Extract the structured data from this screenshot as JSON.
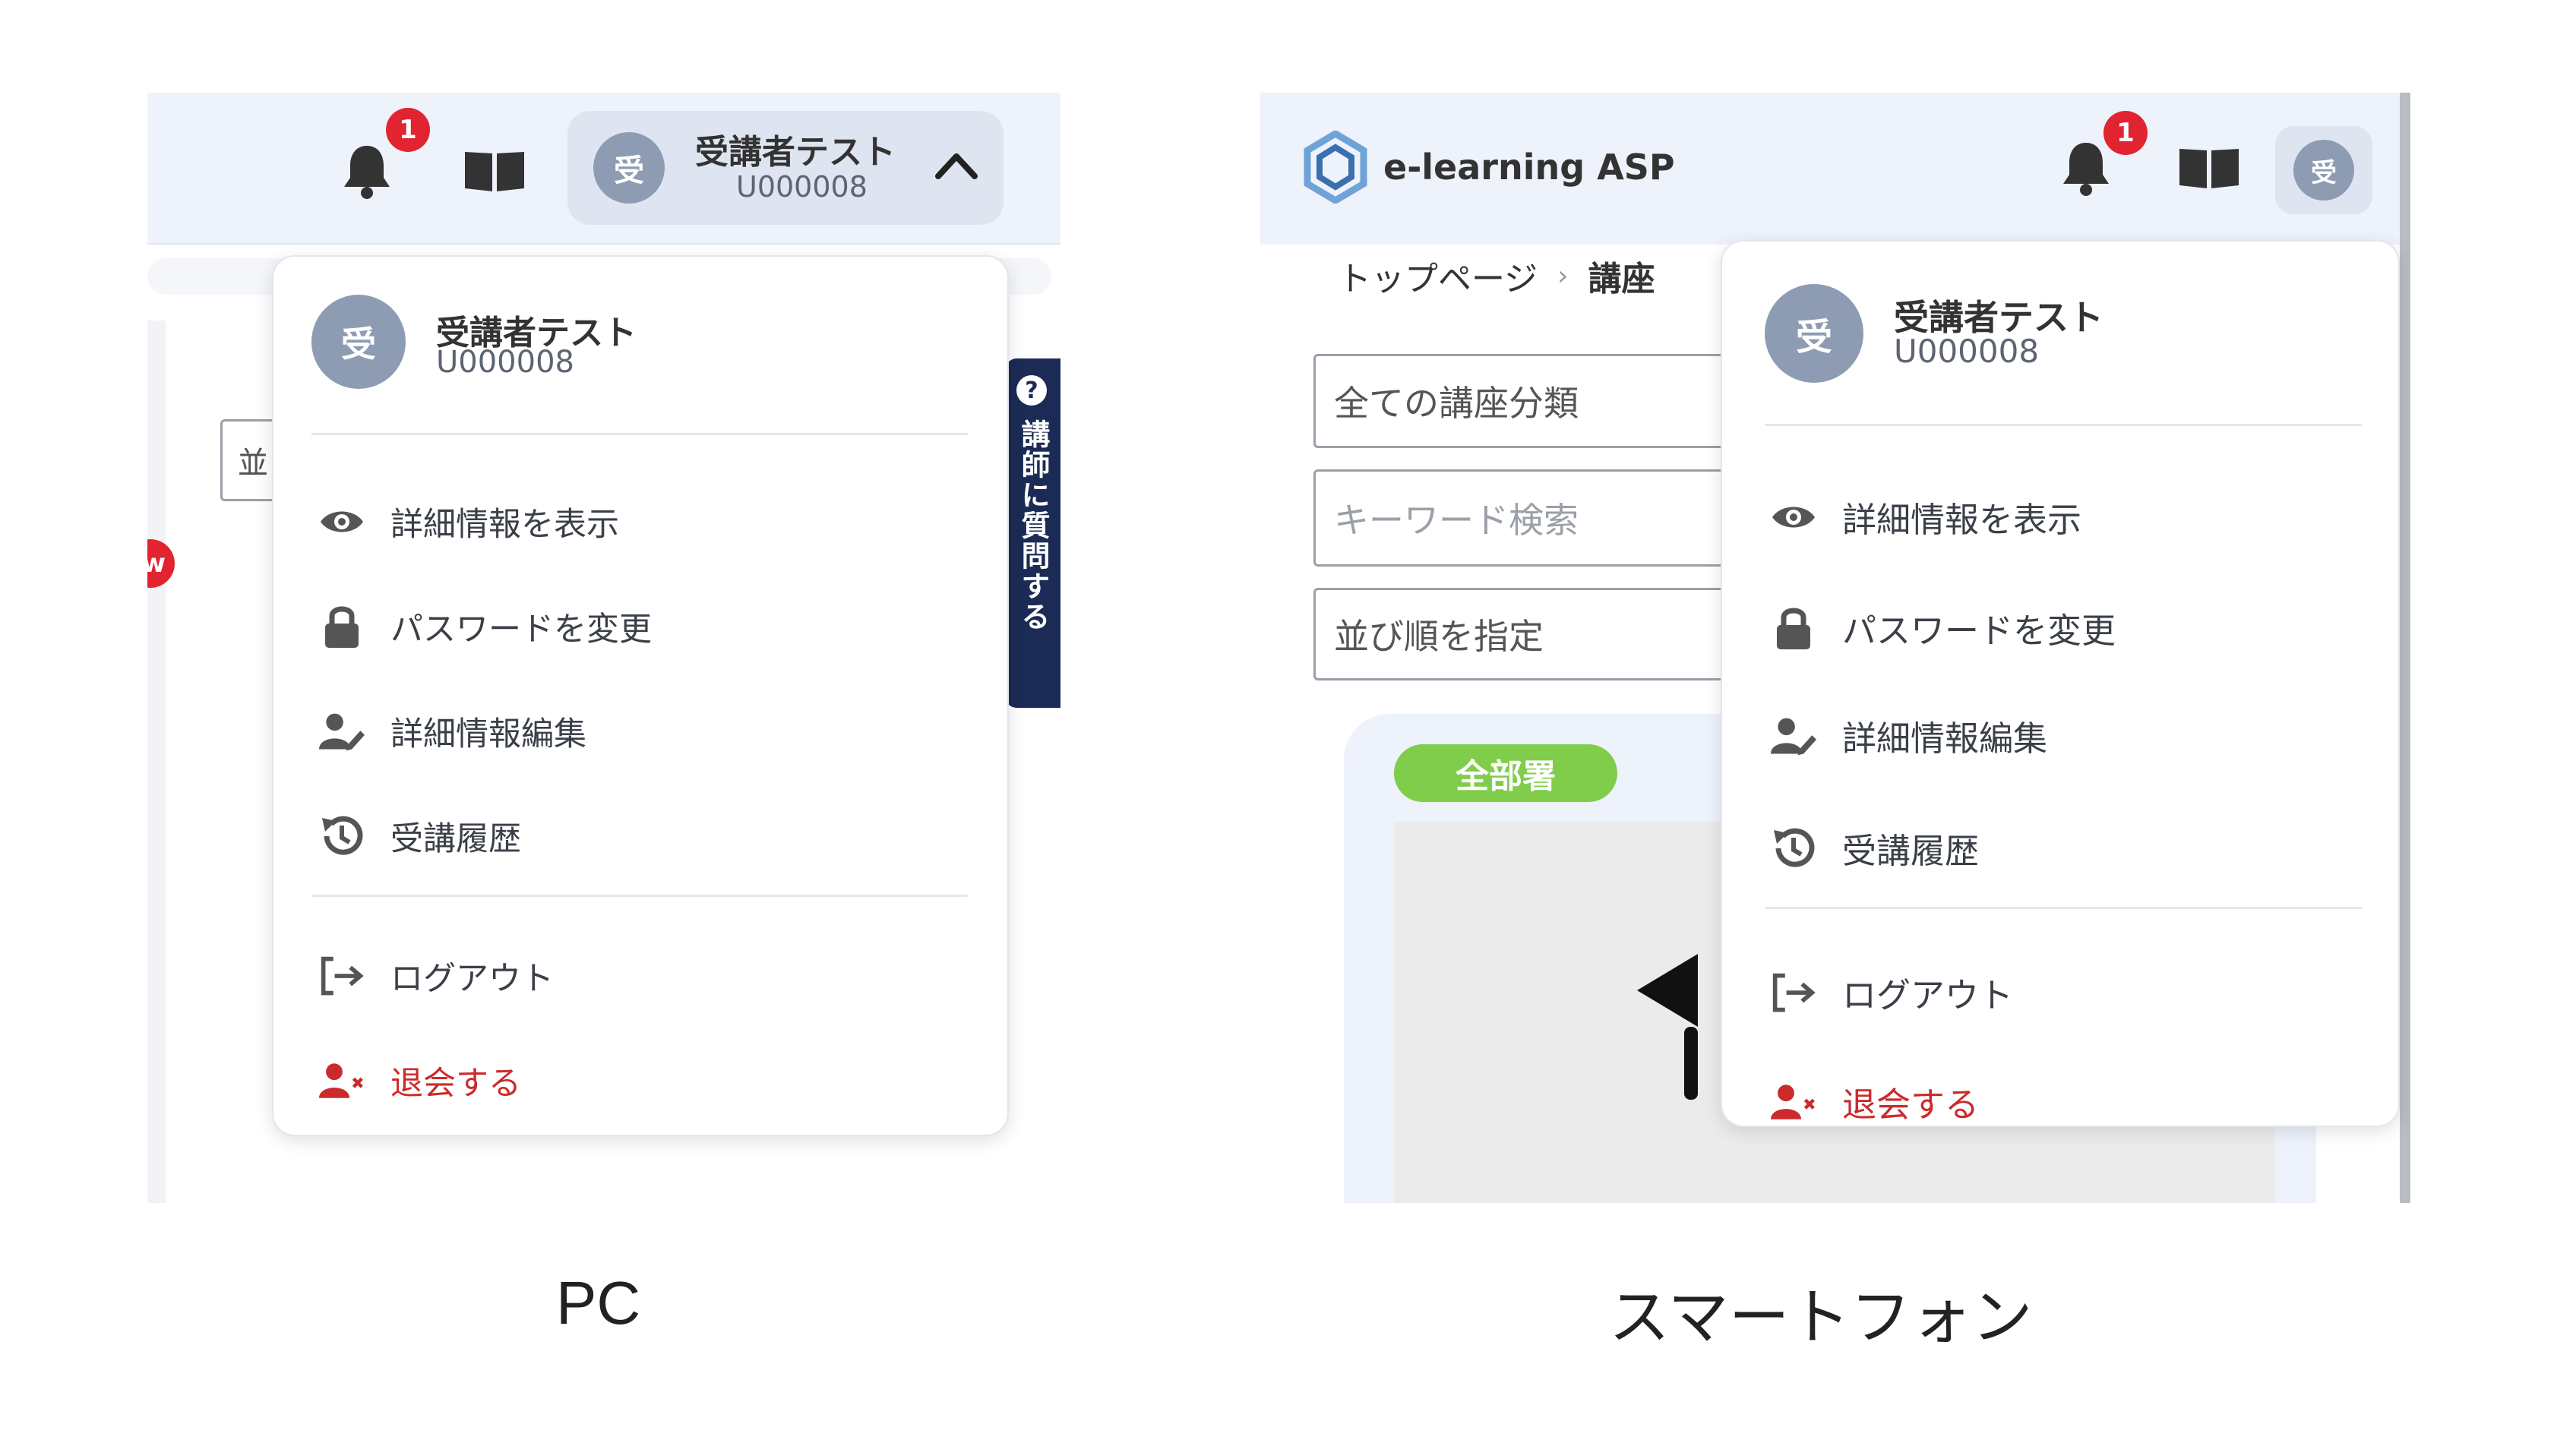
{
  "pc": {
    "notification_count": "1",
    "user": {
      "initial": "受",
      "name": "受講者テスト",
      "id": "U000008"
    },
    "left_tag": "w",
    "sort_field_partial": "並",
    "ask_teacher": {
      "icon": "?",
      "label": "講師に質問する"
    },
    "menu": {
      "items": [
        {
          "label": "詳細情報を表示",
          "icon": "eye-icon"
        },
        {
          "label": "パスワードを変更",
          "icon": "lock-icon"
        },
        {
          "label": "詳細情報編集",
          "icon": "user-edit-icon"
        },
        {
          "label": "受講履歴",
          "icon": "history-icon"
        }
      ],
      "logout": {
        "label": "ログアウト",
        "icon": "logout-icon"
      },
      "withdraw": {
        "label": "退会する",
        "icon": "user-remove-icon"
      }
    }
  },
  "sp": {
    "logo_text": "e-learning ASP",
    "notification_count": "1",
    "user": {
      "initial": "受",
      "name": "受講者テスト",
      "id": "U000008"
    },
    "breadcrumb": {
      "home": "トップページ",
      "separator": "›",
      "current_partial": "講座"
    },
    "filters": {
      "category": "全ての講座分類",
      "keyword_placeholder": "キーワード検索",
      "sort": "並び順を指定"
    },
    "department_badge": "全部署",
    "menu": {
      "items": [
        {
          "label": "詳細情報を表示",
          "icon": "eye-icon"
        },
        {
          "label": "パスワードを変更",
          "icon": "lock-icon"
        },
        {
          "label": "詳細情報編集",
          "icon": "user-edit-icon"
        },
        {
          "label": "受講履歴",
          "icon": "history-icon"
        }
      ],
      "logout": {
        "label": "ログアウト",
        "icon": "logout-icon"
      },
      "withdraw": {
        "label": "退会する",
        "icon": "user-remove-icon"
      }
    }
  },
  "captions": {
    "pc": "PC",
    "sp": "スマートフォン"
  },
  "colors": {
    "header_bg": "#eef2fb",
    "badge_red": "#e1242f",
    "avatar": "#8e9cb3",
    "danger": "#cc2a2a",
    "green_badge": "#7fcd4b",
    "sidebar_navy": "#1c2b55"
  }
}
